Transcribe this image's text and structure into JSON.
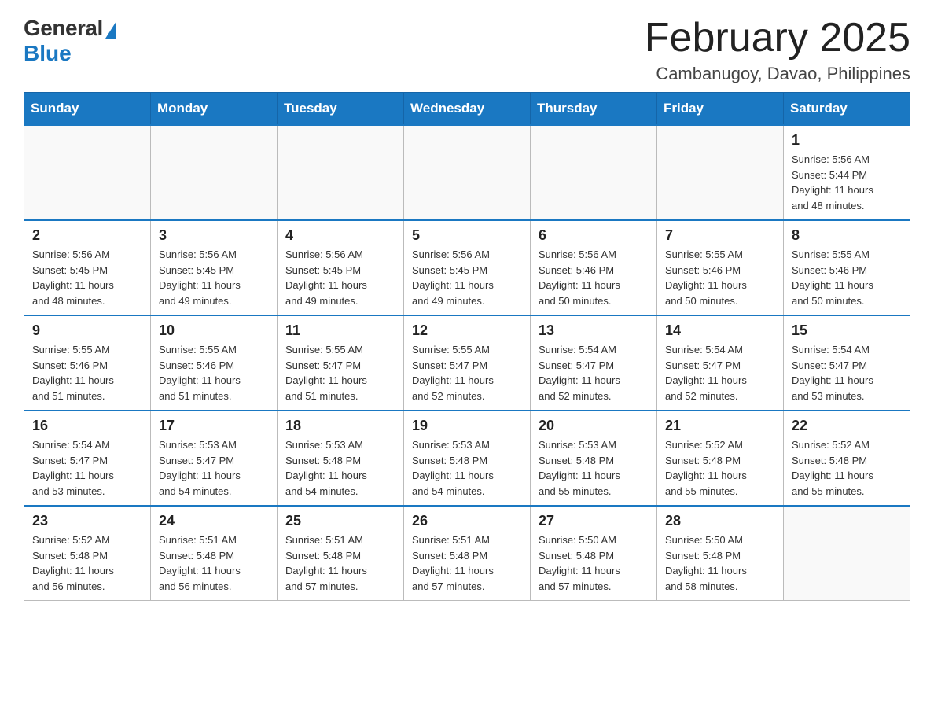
{
  "logo": {
    "general": "General",
    "blue": "Blue"
  },
  "title": "February 2025",
  "subtitle": "Cambanugoy, Davao, Philippines",
  "days_of_week": [
    "Sunday",
    "Monday",
    "Tuesday",
    "Wednesday",
    "Thursday",
    "Friday",
    "Saturday"
  ],
  "weeks": [
    [
      {
        "day": "",
        "info": ""
      },
      {
        "day": "",
        "info": ""
      },
      {
        "day": "",
        "info": ""
      },
      {
        "day": "",
        "info": ""
      },
      {
        "day": "",
        "info": ""
      },
      {
        "day": "",
        "info": ""
      },
      {
        "day": "1",
        "info": "Sunrise: 5:56 AM\nSunset: 5:44 PM\nDaylight: 11 hours\nand 48 minutes."
      }
    ],
    [
      {
        "day": "2",
        "info": "Sunrise: 5:56 AM\nSunset: 5:45 PM\nDaylight: 11 hours\nand 48 minutes."
      },
      {
        "day": "3",
        "info": "Sunrise: 5:56 AM\nSunset: 5:45 PM\nDaylight: 11 hours\nand 49 minutes."
      },
      {
        "day": "4",
        "info": "Sunrise: 5:56 AM\nSunset: 5:45 PM\nDaylight: 11 hours\nand 49 minutes."
      },
      {
        "day": "5",
        "info": "Sunrise: 5:56 AM\nSunset: 5:45 PM\nDaylight: 11 hours\nand 49 minutes."
      },
      {
        "day": "6",
        "info": "Sunrise: 5:56 AM\nSunset: 5:46 PM\nDaylight: 11 hours\nand 50 minutes."
      },
      {
        "day": "7",
        "info": "Sunrise: 5:55 AM\nSunset: 5:46 PM\nDaylight: 11 hours\nand 50 minutes."
      },
      {
        "day": "8",
        "info": "Sunrise: 5:55 AM\nSunset: 5:46 PM\nDaylight: 11 hours\nand 50 minutes."
      }
    ],
    [
      {
        "day": "9",
        "info": "Sunrise: 5:55 AM\nSunset: 5:46 PM\nDaylight: 11 hours\nand 51 minutes."
      },
      {
        "day": "10",
        "info": "Sunrise: 5:55 AM\nSunset: 5:46 PM\nDaylight: 11 hours\nand 51 minutes."
      },
      {
        "day": "11",
        "info": "Sunrise: 5:55 AM\nSunset: 5:47 PM\nDaylight: 11 hours\nand 51 minutes."
      },
      {
        "day": "12",
        "info": "Sunrise: 5:55 AM\nSunset: 5:47 PM\nDaylight: 11 hours\nand 52 minutes."
      },
      {
        "day": "13",
        "info": "Sunrise: 5:54 AM\nSunset: 5:47 PM\nDaylight: 11 hours\nand 52 minutes."
      },
      {
        "day": "14",
        "info": "Sunrise: 5:54 AM\nSunset: 5:47 PM\nDaylight: 11 hours\nand 52 minutes."
      },
      {
        "day": "15",
        "info": "Sunrise: 5:54 AM\nSunset: 5:47 PM\nDaylight: 11 hours\nand 53 minutes."
      }
    ],
    [
      {
        "day": "16",
        "info": "Sunrise: 5:54 AM\nSunset: 5:47 PM\nDaylight: 11 hours\nand 53 minutes."
      },
      {
        "day": "17",
        "info": "Sunrise: 5:53 AM\nSunset: 5:47 PM\nDaylight: 11 hours\nand 54 minutes."
      },
      {
        "day": "18",
        "info": "Sunrise: 5:53 AM\nSunset: 5:48 PM\nDaylight: 11 hours\nand 54 minutes."
      },
      {
        "day": "19",
        "info": "Sunrise: 5:53 AM\nSunset: 5:48 PM\nDaylight: 11 hours\nand 54 minutes."
      },
      {
        "day": "20",
        "info": "Sunrise: 5:53 AM\nSunset: 5:48 PM\nDaylight: 11 hours\nand 55 minutes."
      },
      {
        "day": "21",
        "info": "Sunrise: 5:52 AM\nSunset: 5:48 PM\nDaylight: 11 hours\nand 55 minutes."
      },
      {
        "day": "22",
        "info": "Sunrise: 5:52 AM\nSunset: 5:48 PM\nDaylight: 11 hours\nand 55 minutes."
      }
    ],
    [
      {
        "day": "23",
        "info": "Sunrise: 5:52 AM\nSunset: 5:48 PM\nDaylight: 11 hours\nand 56 minutes."
      },
      {
        "day": "24",
        "info": "Sunrise: 5:51 AM\nSunset: 5:48 PM\nDaylight: 11 hours\nand 56 minutes."
      },
      {
        "day": "25",
        "info": "Sunrise: 5:51 AM\nSunset: 5:48 PM\nDaylight: 11 hours\nand 57 minutes."
      },
      {
        "day": "26",
        "info": "Sunrise: 5:51 AM\nSunset: 5:48 PM\nDaylight: 11 hours\nand 57 minutes."
      },
      {
        "day": "27",
        "info": "Sunrise: 5:50 AM\nSunset: 5:48 PM\nDaylight: 11 hours\nand 57 minutes."
      },
      {
        "day": "28",
        "info": "Sunrise: 5:50 AM\nSunset: 5:48 PM\nDaylight: 11 hours\nand 58 minutes."
      },
      {
        "day": "",
        "info": ""
      }
    ]
  ]
}
